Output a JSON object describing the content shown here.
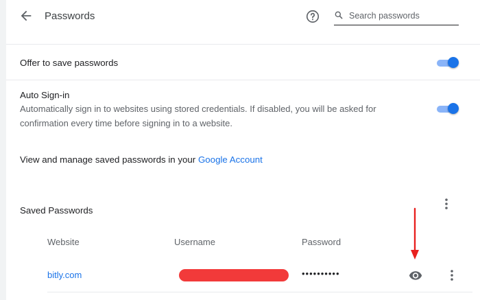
{
  "header": {
    "title": "Passwords",
    "search_placeholder": "Search passwords"
  },
  "settings": {
    "offer_to_save": {
      "label": "Offer to save passwords",
      "enabled": true
    },
    "auto_signin": {
      "label": "Auto Sign-in",
      "description": "Automatically sign in to websites using stored credentials. If disabled, you will be asked for confirmation every time before signing in to a website.",
      "enabled": true
    },
    "manage": {
      "text": "View and manage saved passwords in your ",
      "link": "Google Account"
    }
  },
  "saved_passwords": {
    "title": "Saved Passwords",
    "columns": {
      "website": "Website",
      "username": "Username",
      "password": "Password"
    },
    "rows": [
      {
        "website": "bitly.com",
        "username_redacted": true,
        "password_mask": "••••••••••"
      }
    ]
  },
  "colors": {
    "accent": "#1a73e8",
    "toggle_track": "#8ab4f8",
    "redaction": "#f23a3a",
    "annotation_arrow": "#e8211f"
  },
  "icons": [
    "back-arrow-icon",
    "help-icon",
    "search-icon",
    "more-vert-icon",
    "eye-icon"
  ]
}
